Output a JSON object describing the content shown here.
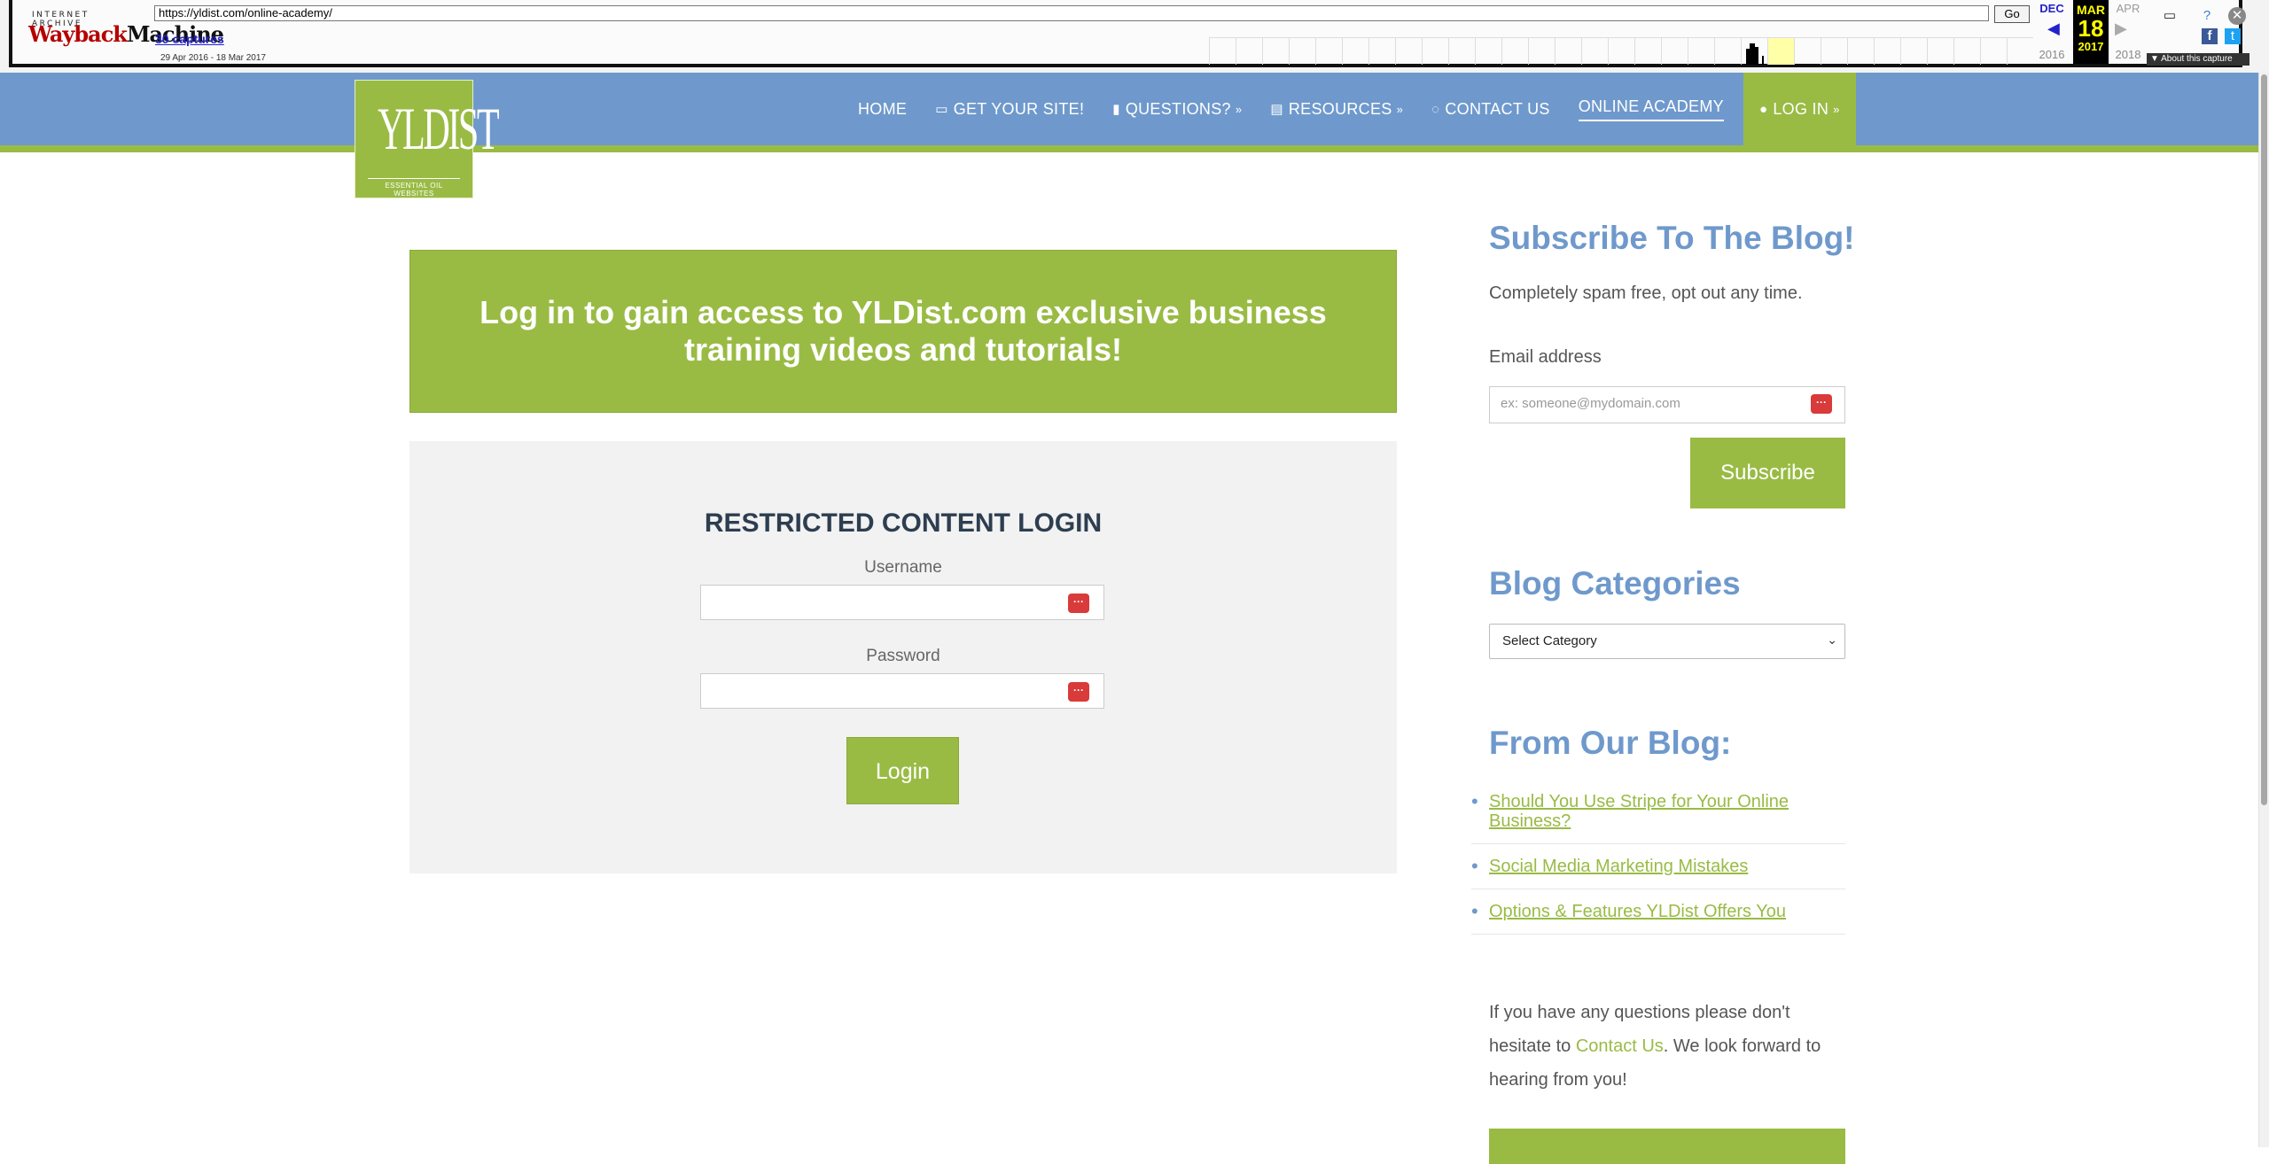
{
  "wayback": {
    "logo_top": "INTERNET ARCHIVE",
    "logo_way": "Wayback",
    "logo_machine": "Machine",
    "url": "https://yldist.com/online-academy/",
    "go_label": "Go",
    "captures": "30 captures",
    "range": "29 Apr 2016 - 18 Mar 2017",
    "prev_month": "DEC",
    "cur_month": "MAR",
    "cur_day": "18",
    "cur_year": "2017",
    "next_month": "APR",
    "prev_year": "2016",
    "next_year": "2018",
    "about": "▼ About this capture"
  },
  "nav": {
    "items": [
      {
        "label": "HOME"
      },
      {
        "label": "GET YOUR SITE!"
      },
      {
        "label": "QUESTIONS?"
      },
      {
        "label": "RESOURCES"
      },
      {
        "label": "CONTACT US"
      },
      {
        "label": "ONLINE ACADEMY"
      },
      {
        "label": "LOG IN"
      }
    ]
  },
  "logo": {
    "text": "YLDIST",
    "tagline": "ESSENTIAL OIL WEBSITES"
  },
  "main": {
    "banner": "Log in to gain access to YLDist.com exclusive business training videos and tutorials!",
    "login_title": "RESTRICTED CONTENT LOGIN",
    "username_label": "Username",
    "password_label": "Password",
    "login_button": "Login",
    "input_badge": "···"
  },
  "sidebar": {
    "subscribe_title": "Subscribe To The Blog!",
    "subscribe_text": "Completely spam free, opt out any time.",
    "email_label": "Email address",
    "email_placeholder": "ex: someone@mydomain.com",
    "subscribe_button": "Subscribe",
    "categories_title": "Blog Categories",
    "categories_selected": "Select Category",
    "from_blog_title": "From Our Blog:",
    "posts": [
      {
        "title": "Should You Use Stripe for Your Online Business?"
      },
      {
        "title": "Social Media Marketing Mistakes"
      },
      {
        "title": "Options & Features YLDist Offers You"
      }
    ],
    "contact_pre": "If you have any questions please don't hesitate to ",
    "contact_link": "Contact Us",
    "contact_post": ". We look forward to hearing from you!"
  },
  "colors": {
    "header_blue": "#6f99cc",
    "brand_green": "#99bb44",
    "alert_red": "#d93a3a"
  }
}
